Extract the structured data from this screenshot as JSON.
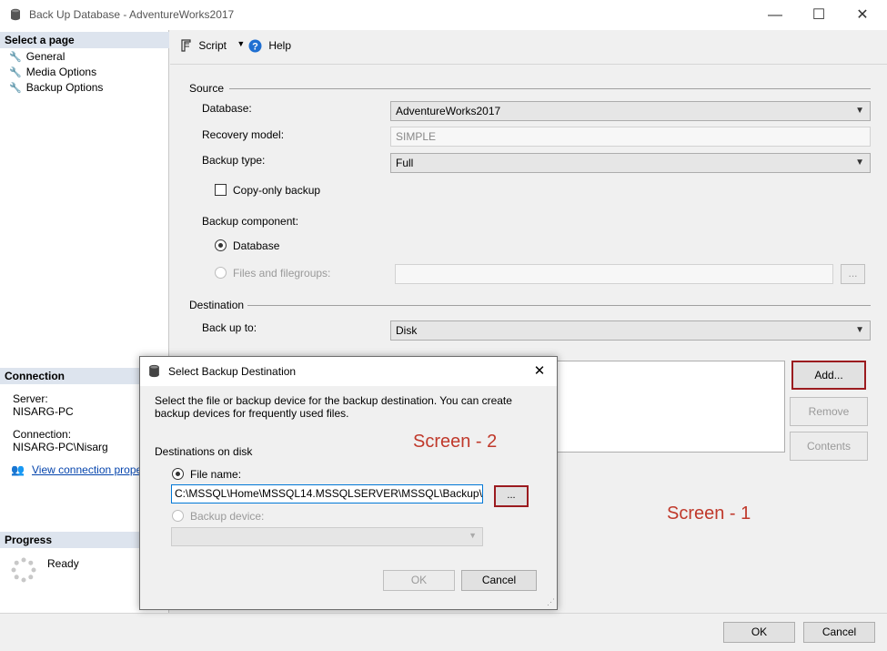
{
  "window": {
    "title": "Back Up Database - AdventureWorks2017",
    "controls": {
      "minimize": "—",
      "maximize": "☐",
      "close": "✕"
    }
  },
  "left": {
    "select_page_header": "Select a page",
    "pages": [
      "General",
      "Media Options",
      "Backup Options"
    ],
    "connection_header": "Connection",
    "server_label": "Server:",
    "server_value": "NISARG-PC",
    "connection_label": "Connection:",
    "connection_value": "NISARG-PC\\Nisarg",
    "view_link": "View connection proper",
    "progress_header": "Progress",
    "progress_status": "Ready"
  },
  "toolbar": {
    "script_label": "Script",
    "help_label": "Help"
  },
  "source": {
    "header": "Source",
    "database_label": "Database:",
    "database_value": "AdventureWorks2017",
    "recovery_label": "Recovery model:",
    "recovery_value": "SIMPLE",
    "backup_type_label": "Backup type:",
    "backup_type_value": "Full",
    "copy_only_label": "Copy-only backup",
    "component_label": "Backup component:",
    "component_database": "Database",
    "component_files": "Files and filegroups:",
    "files_browse": "..."
  },
  "destination": {
    "header": "Destination",
    "backup_to_label": "Back up to:",
    "backup_to_value": "Disk",
    "add_button": "Add...",
    "remove_button": "Remove",
    "contents_button": "Contents"
  },
  "annotations": {
    "screen1": "Screen - 1",
    "screen2": "Screen - 2"
  },
  "bottom": {
    "ok": "OK",
    "cancel": "Cancel"
  },
  "dialog": {
    "title": "Select Backup Destination",
    "close": "✕",
    "desc_line1": "Select the file or backup device for the backup destination. You can create",
    "desc_line2": "backup devices for frequently used files.",
    "destinations_label": "Destinations on disk",
    "file_name_label": "File name:",
    "file_name_value": "C:\\MSSQL\\Home\\MSSQL14.MSSQLSERVER\\MSSQL\\Backup\\",
    "browse": "...",
    "backup_device_label": "Backup device:",
    "ok": "OK",
    "cancel": "Cancel"
  },
  "colors": {
    "annotation_red": "#c0392b",
    "highlight_border": "#9b1b1f",
    "section_header": "#dde4ee"
  }
}
